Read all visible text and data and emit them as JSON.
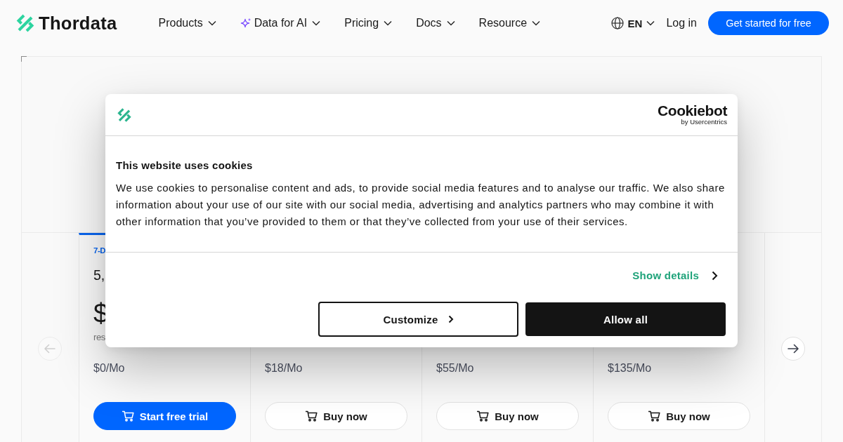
{
  "header": {
    "logo": "Thordata",
    "nav": [
      {
        "label": "Products",
        "kind": "menu"
      },
      {
        "label": "Data for AI",
        "kind": "featured"
      },
      {
        "label": "Pricing",
        "kind": "menu"
      },
      {
        "label": "Docs",
        "kind": "menu"
      },
      {
        "label": "Resource",
        "kind": "menu"
      }
    ],
    "language": "EN",
    "login": "Log in",
    "cta": "Get started for free"
  },
  "pricing": {
    "plans": [
      {
        "label": "7-D",
        "title": "5,",
        "price": "$",
        "note": "res",
        "monthly": "$0/Mo",
        "button": "Start free trial",
        "selected": true
      },
      {
        "monthly": "$18/Mo",
        "button": "Buy now",
        "selected": false
      },
      {
        "monthly": "$55/Mo",
        "button": "Buy now",
        "selected": false
      },
      {
        "monthly": "$135/Mo",
        "button": "Buy now",
        "selected": false
      }
    ],
    "carousel": {
      "previous": {
        "disabled": true
      },
      "next": {
        "disabled": false
      }
    }
  },
  "cookie_dialog": {
    "brand": {
      "name": "Cookiebot",
      "byline": "by Usercentrics"
    },
    "title": "This website uses cookies",
    "text": "We use cookies to personalise content and ads, to provide social media features and to analyse our traffic. We also share information about your use of our site with our social media, advertising and analytics partners who may combine it with other information that you’ve provided to them or that they’ve collected from your use of their services.",
    "details_link": "Show details",
    "actions": [
      {
        "label": "Customize",
        "kind": "outline"
      },
      {
        "label": "Allow all",
        "kind": "solid"
      }
    ]
  }
}
